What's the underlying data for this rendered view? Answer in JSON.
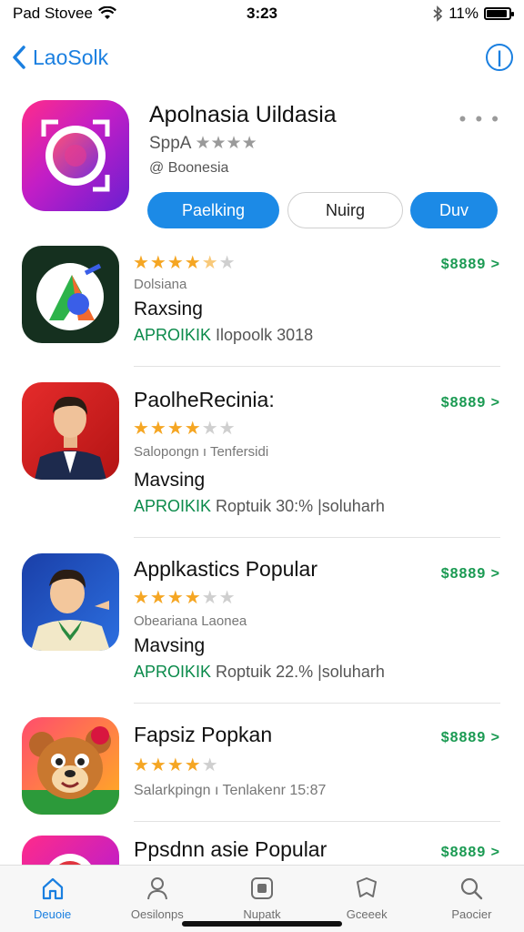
{
  "status_bar": {
    "carrier": "Pad Stovee",
    "time": "3:23",
    "battery_pct": "11%"
  },
  "nav": {
    "back_label": "LaoSolk"
  },
  "hero": {
    "title": "Apolnasia Uildasia",
    "subtitle": "SppA",
    "rating_stars": 4,
    "meta": "@ Boonesia",
    "buttons": [
      "Paelking",
      "Nuirg",
      "Duv"
    ]
  },
  "apps": [
    {
      "title": "",
      "stars": 4.5,
      "sub1": "Dolsiana",
      "sub2": "Raxsing",
      "meta_tag": "APROIKIK",
      "meta_rest": "Ilopoolk   3018",
      "price": "$8889 >"
    },
    {
      "title": "PaolheRecinia:",
      "stars": 4,
      "sub1": "Salopongn ı Tenfersidi",
      "sub2": "Mavsing",
      "meta_tag": "APROIKIK",
      "meta_rest": "Roptuik   30:%   |soluharh",
      "price": "$8889 >"
    },
    {
      "title": "Applkastics Popular",
      "stars": 4,
      "sub1": "Obeariana Laonea",
      "sub2": "Mavsing",
      "meta_tag": "APROIKIK",
      "meta_rest": "Roptuik   22.%   |soluharh",
      "price": "$8889 >"
    },
    {
      "title": "Fapsiz Popkan",
      "stars": 4,
      "sub1": "Salarkpingn ı Tenlakenr   15:87",
      "sub2": "",
      "meta_tag": "",
      "meta_rest": "",
      "price": "$8889 >"
    },
    {
      "title": "Ppsdnn asie Popular",
      "stars": 0,
      "sub1": "",
      "sub2": "",
      "meta_tag": "",
      "meta_rest": "",
      "price": "$8889 >"
    }
  ],
  "tabs": [
    {
      "label": "Deuoie",
      "icon": "home-icon",
      "active": true
    },
    {
      "label": "Oesilonps",
      "icon": "person-icon",
      "active": false
    },
    {
      "label": "Nupatk",
      "icon": "store-icon",
      "active": false
    },
    {
      "label": "Gceeek",
      "icon": "heart-tag-icon",
      "active": false
    },
    {
      "label": "Paocier",
      "icon": "search-icon",
      "active": false
    }
  ],
  "colors": {
    "accent": "#1a7fe0",
    "price": "#1a9a52",
    "star": "#f5a623"
  }
}
